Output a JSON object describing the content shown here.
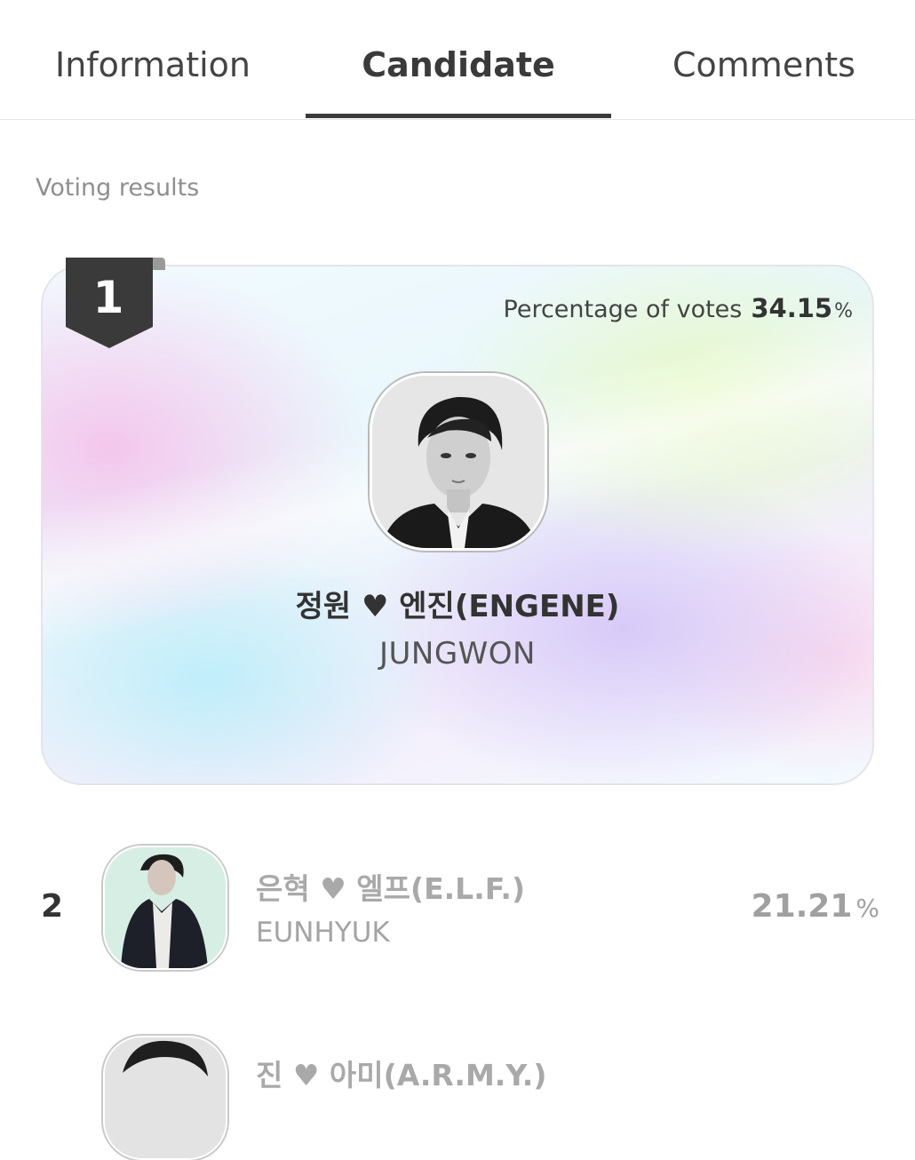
{
  "tabs": [
    {
      "label": "Information",
      "active": false
    },
    {
      "label": "Candidate",
      "active": true
    },
    {
      "label": "Comments",
      "active": false
    }
  ],
  "section_label": "Voting results",
  "winner": {
    "rank": "1",
    "percentage_label": "Percentage of votes",
    "percentage_value": "34.15",
    "percentage_unit": "%",
    "title": "정원 ♥ 엔진(ENGENE)",
    "name": "JUNGWON",
    "avatar": "portrait-photo"
  },
  "candidates": [
    {
      "rank": "2",
      "title": "은혁 ♥ 엘프(E.L.F.)",
      "name": "EUNHYUK",
      "percentage_value": "21.21",
      "percentage_unit": "%",
      "avatar": "portrait-photo"
    },
    {
      "title": "진 ♥ 아미(A.R.M.Y.)",
      "avatar": "portrait-photo"
    }
  ],
  "colors": {
    "active_tab": "#3a3a3a",
    "muted_text": "#a9a9a9",
    "ribbon": "#3a3a3a"
  }
}
